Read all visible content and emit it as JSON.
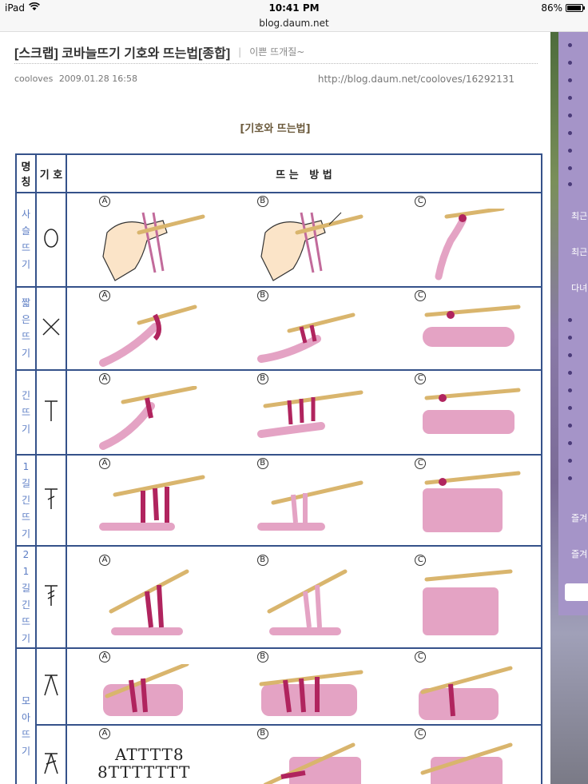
{
  "status_bar": {
    "device": "iPad",
    "time": "10:41 PM",
    "battery": "86%",
    "url": "blog.daum.net"
  },
  "post": {
    "title": "[스크랩] 코바늘뜨기 기호와 뜨는법[종합]",
    "category": "이쁜 뜨개질~",
    "author": "cooloves",
    "date": "2009.01.28 16:58",
    "permalink": "http://blog.daum.net/cooloves/16292131",
    "section_title": "[기호와 뜨는법]"
  },
  "table": {
    "header_name": "명칭",
    "header_symbol": "기 호",
    "header_method": "뜨 는   방 법",
    "step_labels": [
      "A",
      "B",
      "C"
    ],
    "rows": [
      {
        "name": "사슬뜨기",
        "symbol": "chain-oval"
      },
      {
        "name": "짧은뜨기",
        "symbol": "x-cross"
      },
      {
        "name": "긴뜨기",
        "symbol": "t-bar"
      },
      {
        "name": "1길긴뜨기",
        "symbol": "t-bar-1"
      },
      {
        "name": "21길긴뜨기",
        "symbol": "t-bar-2"
      },
      {
        "name": "모아뜨기",
        "symbol": "cluster"
      },
      {
        "name": "",
        "symbol": "cluster-2"
      }
    ],
    "chart_glyphs": {
      "top": "ATTTT8",
      "bottom": "8TTTTTTT"
    }
  },
  "sidebar": {
    "labels": [
      "최근",
      "최근",
      "다녀",
      "즐겨",
      "즐겨"
    ]
  },
  "colors": {
    "table_border": "#35528a",
    "name_text": "#5c7dc4",
    "yarn_pink": "#e4a3c4",
    "yarn_magenta": "#b0245e",
    "hook": "#d9b56d",
    "sidebar_panel": "#a594c8"
  }
}
